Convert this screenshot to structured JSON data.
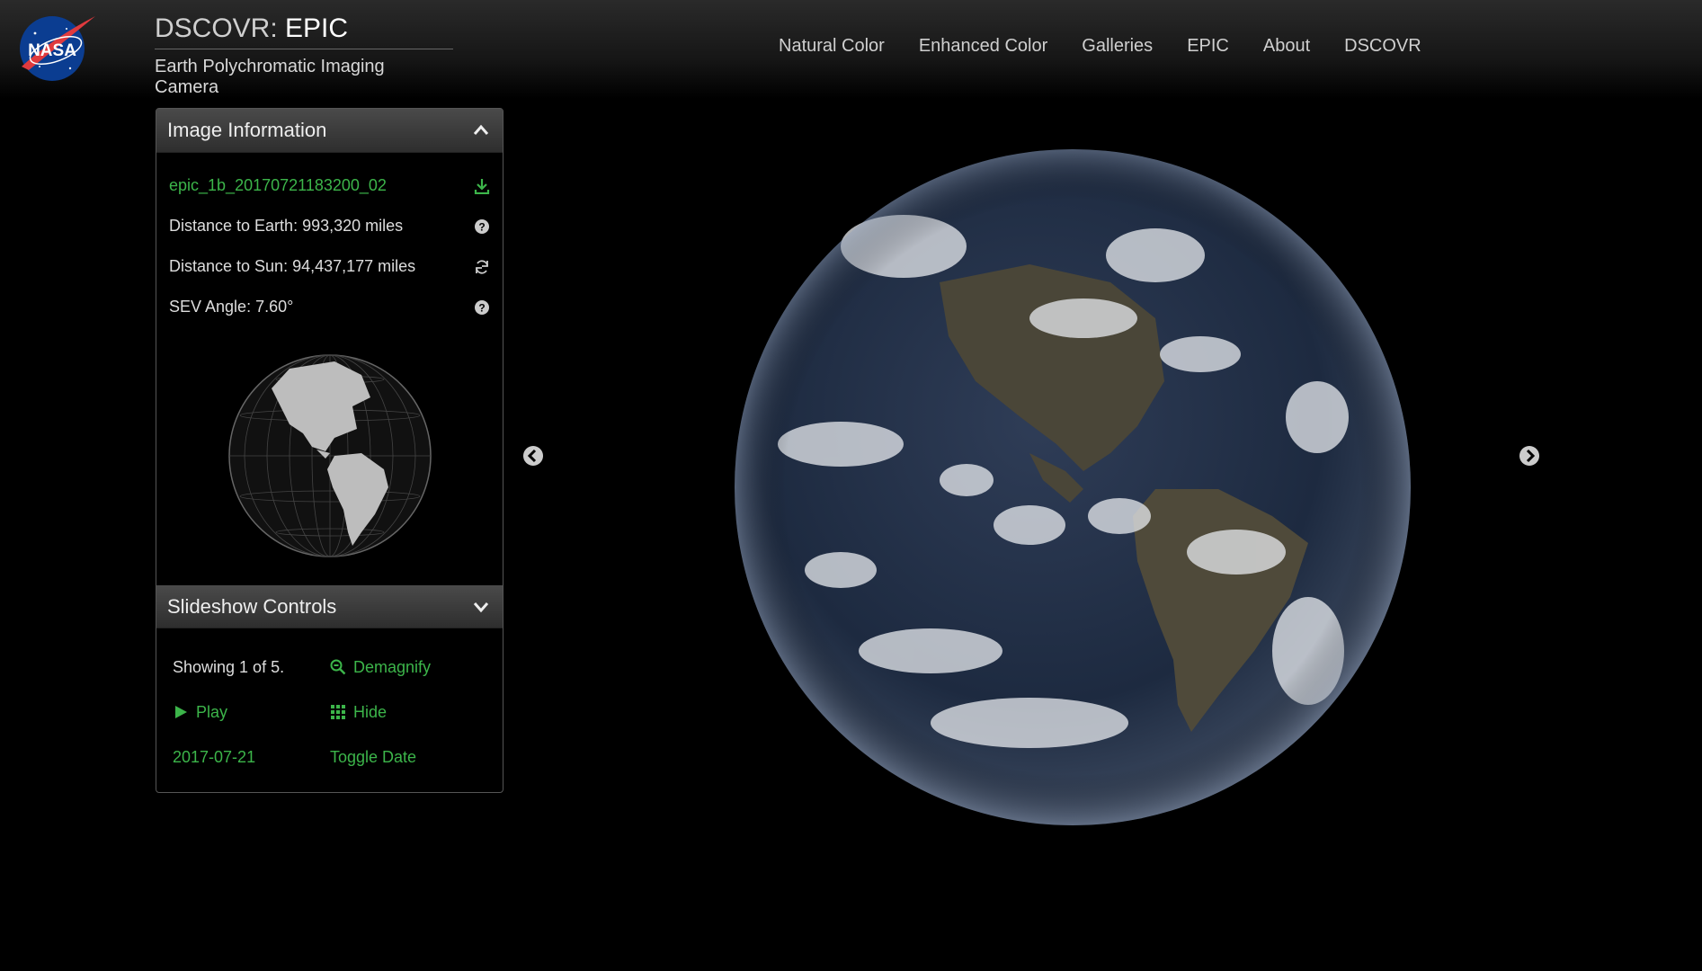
{
  "header": {
    "logo_text": "NASA",
    "title_prefix": "DSCOVR: ",
    "title_strong": "EPIC",
    "subtitle": "Earth Polychromatic Imaging Camera"
  },
  "nav": [
    "Natural Color",
    "Enhanced Color",
    "Galleries",
    "EPIC",
    "About",
    "DSCOVR"
  ],
  "image_info": {
    "heading": "Image Information",
    "filename": "epic_1b_20170721183200_02",
    "distance_earth": "Distance to Earth: 993,320 miles",
    "distance_sun": "Distance to Sun: 94,437,177 miles",
    "sev_angle": "SEV Angle: 7.60°"
  },
  "slideshow": {
    "heading": "Slideshow Controls",
    "showing": "Showing 1 of 5.",
    "demagnify": "Demagnify",
    "play": "Play",
    "hide": "Hide",
    "date": "2017-07-21",
    "toggle_date": "Toggle Date"
  },
  "colors": {
    "accent_green": "#3cb54a",
    "background": "#000000"
  },
  "icons": [
    "download-icon",
    "help-icon",
    "refresh-icon",
    "chevron-up-icon",
    "chevron-down-icon",
    "zoom-out-icon",
    "play-icon",
    "grid-icon",
    "arrow-left-icon",
    "arrow-right-icon"
  ]
}
